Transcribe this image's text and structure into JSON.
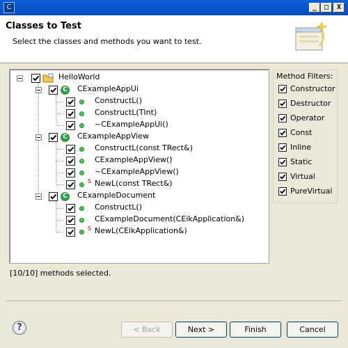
{
  "window": {
    "app_icon_glyph": "C",
    "minimize_glyph": "_",
    "maximize_glyph": "□",
    "close_glyph": "X"
  },
  "header": {
    "title": "Classes to Test",
    "description": "Select the classes and methods you want to test."
  },
  "tree": {
    "root": {
      "label": "HelloWorld",
      "checked": true
    },
    "classes": [
      {
        "label": "CExampleAppUi",
        "icon_letter": "C",
        "checked": true,
        "methods": [
          {
            "label": "ConstructL()",
            "checked": true,
            "static": false
          },
          {
            "label": "ConstructL(TInt)",
            "checked": true,
            "static": false
          },
          {
            "label": "~CExampleAppUi()",
            "checked": true,
            "static": false
          }
        ]
      },
      {
        "label": "CExampleAppView",
        "icon_letter": "C",
        "checked": true,
        "methods": [
          {
            "label": "ConstructL(const TRect&)",
            "checked": true,
            "static": false
          },
          {
            "label": "CExampleAppView()",
            "checked": true,
            "static": false
          },
          {
            "label": "~CExampleAppView()",
            "checked": true,
            "static": false
          },
          {
            "label": "NewL(const TRect&)",
            "checked": true,
            "static": true
          }
        ]
      },
      {
        "label": "CExampleDocument",
        "icon_letter": "C",
        "checked": true,
        "methods": [
          {
            "label": "ConstructL()",
            "checked": true,
            "static": false
          },
          {
            "label": "CExampleDocument(CEikApplication&)",
            "checked": true,
            "static": false
          },
          {
            "label": "NewL(CEikApplication&)",
            "checked": true,
            "static": true
          }
        ]
      }
    ],
    "static_marker": "S"
  },
  "filters": {
    "legend": "Method Filters:",
    "items": [
      {
        "label": "Constructor",
        "checked": true
      },
      {
        "label": "Destructor",
        "checked": true
      },
      {
        "label": "Operator",
        "checked": true
      },
      {
        "label": "Const",
        "checked": true
      },
      {
        "label": "Inline",
        "checked": true
      },
      {
        "label": "Static",
        "checked": true
      },
      {
        "label": "Virtual",
        "checked": true
      },
      {
        "label": "PureVirtual",
        "checked": true
      }
    ]
  },
  "status": "[10/10] methods selected.",
  "buttons": {
    "help_glyph": "?",
    "back": "< Back",
    "next": "Next >",
    "finish": "Finish",
    "cancel": "Cancel",
    "back_enabled": false
  }
}
